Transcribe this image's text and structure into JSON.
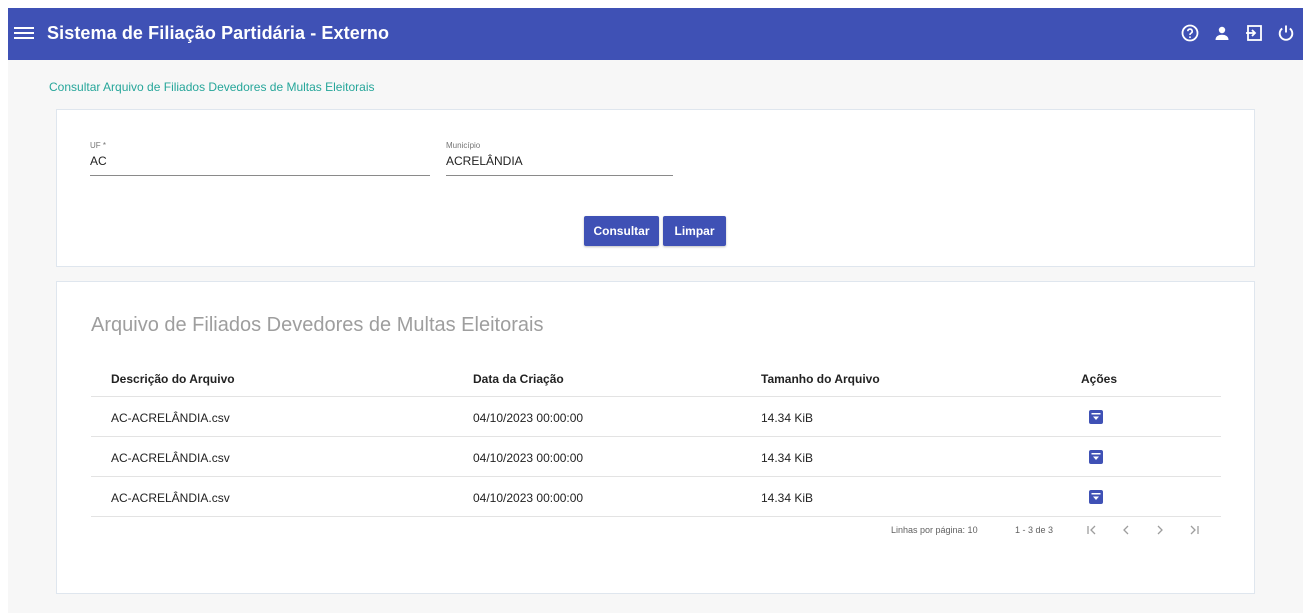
{
  "header": {
    "title": "Sistema de Filiação Partidária - Externo",
    "icons": [
      "menu-icon",
      "help-icon",
      "user-icon",
      "logout-icon",
      "power-icon"
    ]
  },
  "breadcrumb": "Consultar Arquivo de Filiados Devedores de Multas Eleitorais",
  "filters": {
    "uf": {
      "label": "UF *",
      "value": "AC"
    },
    "municipio": {
      "label": "Município",
      "value": "ACRELÂNDIA"
    },
    "consultar_label": "Consultar",
    "limpar_label": "Limpar"
  },
  "results": {
    "title": "Arquivo de Filiados Devedores de Multas Eleitorais",
    "columns": [
      "Descrição do Arquivo",
      "Data da Criação",
      "Tamanho do Arquivo",
      "Ações"
    ],
    "rows": [
      {
        "descricao": "AC-ACRELÂNDIA.csv",
        "data": "04/10/2023 00:00:00",
        "tamanho": "14.34 KiB",
        "acao_icon": "download-icon"
      },
      {
        "descricao": "AC-ACRELÂNDIA.csv",
        "data": "04/10/2023 00:00:00",
        "tamanho": "14.34 KiB",
        "acao_icon": "download-icon"
      },
      {
        "descricao": "AC-ACRELÂNDIA.csv",
        "data": "04/10/2023 00:00:00",
        "tamanho": "14.34 KiB",
        "acao_icon": "download-icon"
      }
    ],
    "paginator": {
      "rows_per_page": "Linhas por página: 10",
      "range": "1 - 3 de 3"
    }
  },
  "colors": {
    "primary": "#3f51b5",
    "breadcrumb": "#26a69a",
    "title_muted": "#9e9e9e"
  }
}
